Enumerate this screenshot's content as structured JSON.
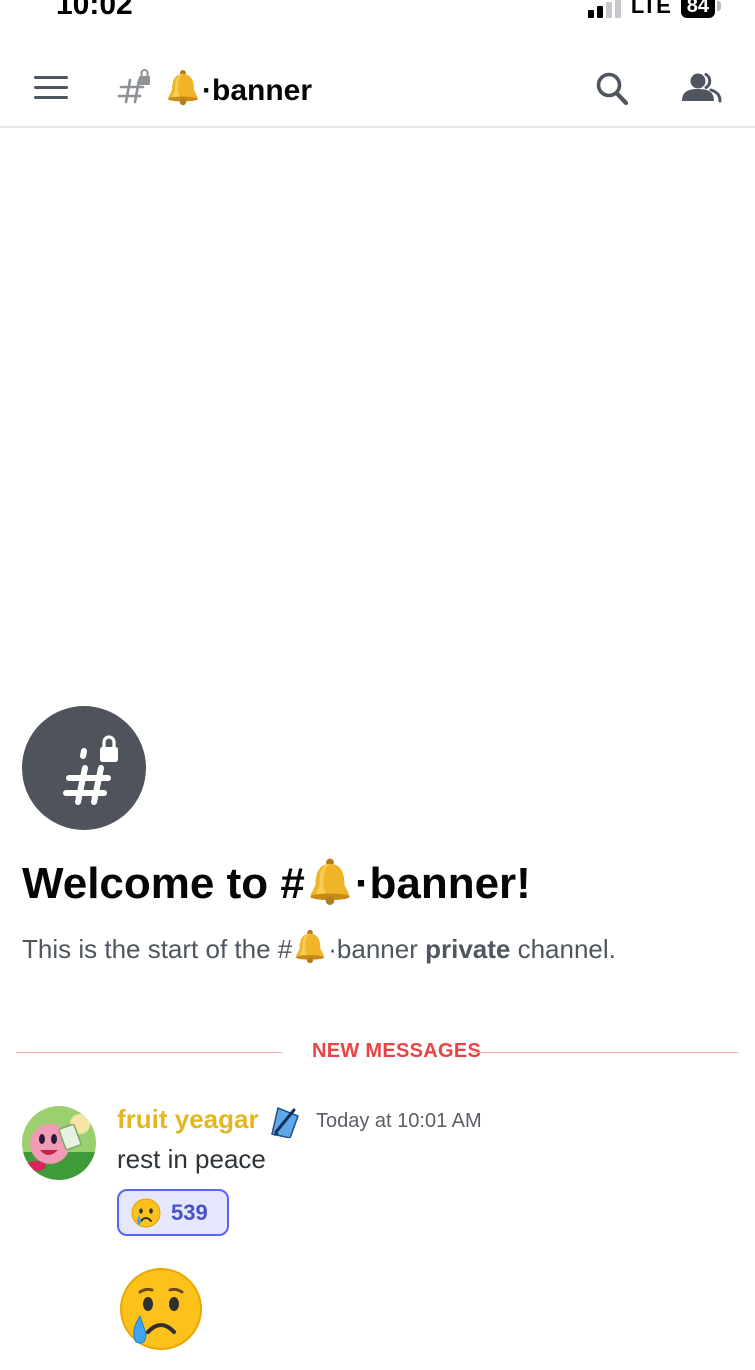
{
  "status_bar": {
    "time": "10:02",
    "network": "LTE",
    "battery": "84"
  },
  "header": {
    "menu_icon": "hamburger-menu-icon",
    "channel_icon": "locked-hash-icon",
    "channel_name": "·banner",
    "search_icon": "search-icon",
    "members_icon": "members-icon"
  },
  "intro": {
    "welcome_prefix": "Welcome to #",
    "welcome_suffix": "·banner!",
    "text_prefix": "This is the start of the #",
    "text_channel": "·banner",
    "text_bold": "private",
    "text_suffix": "channel."
  },
  "divider": {
    "label": "NEW MESSAGES"
  },
  "message": {
    "author": "fruit yeagar",
    "timestamp": "Today at 10:01 AM",
    "text": "rest in peace",
    "reaction": {
      "emoji": "crying-face",
      "count": "539"
    },
    "attachment_emoji": "crying-face"
  },
  "colors": {
    "author": "#e3b623",
    "new_messages": "#ed4245",
    "reaction_border": "#5865f2",
    "reaction_bg": "#e5e7fd"
  }
}
